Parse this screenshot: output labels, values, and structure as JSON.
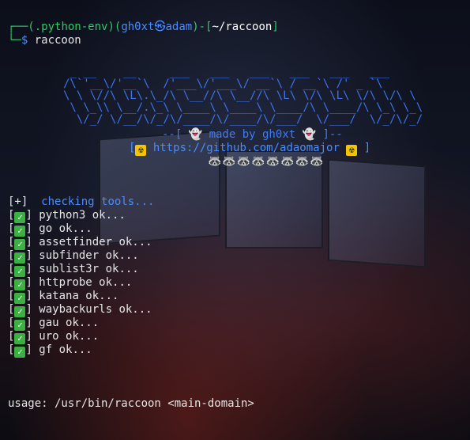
{
  "prompt": {
    "env": "(.python-env)",
    "user": "gh0xt",
    "skull": "㉿",
    "host": "adam",
    "dir": "~/raccoon",
    "command": "raccoon"
  },
  "banner": {
    "ascii": " _ __    __     ___   ___   ___   ___   ___   ___\n/\\`'__\\/'__`\\  /'___\\/'___\\/ __`\\ / __`\\ /' _ `\\\n\\ \\ \\//\\ \\L\\.\\_/\\ \\__//\\ \\__//\\ \\L\\ \\/\\ \\L\\ \\/\\ \\/\\ \\\n \\ \\_\\\\ \\__/.\\_\\ \\____\\ \\____\\ \\____/\\ \\____/\\ \\_\\ \\_\\\n  \\/_/ \\/__/\\/_/\\/____/\\/____/\\/___/  \\/___/  \\/_/\\/_/",
    "made_by": "--[ 👻 made by gh0xt 👻 ]--",
    "link": "https://github.com/adaomajor",
    "raccoons": "🦝🦝🦝🦝🦝🦝🦝🦝"
  },
  "checks": {
    "header_marker": "[+]",
    "header": "checking tools...",
    "tools": [
      "python3 ok...",
      "go ok...",
      "assetfinder ok...",
      "subfinder ok...",
      "sublist3r ok...",
      "httprobe ok...",
      "katana ok...",
      "waybackurls ok...",
      "gau ok...",
      "uro ok...",
      "gf ok..."
    ]
  },
  "usage": "usage: /usr/bin/raccoon <main-domain>",
  "colors": {
    "prompt_green": "#2ec76b",
    "prompt_blue": "#3f7cf2",
    "check_green": "#3cb043"
  }
}
